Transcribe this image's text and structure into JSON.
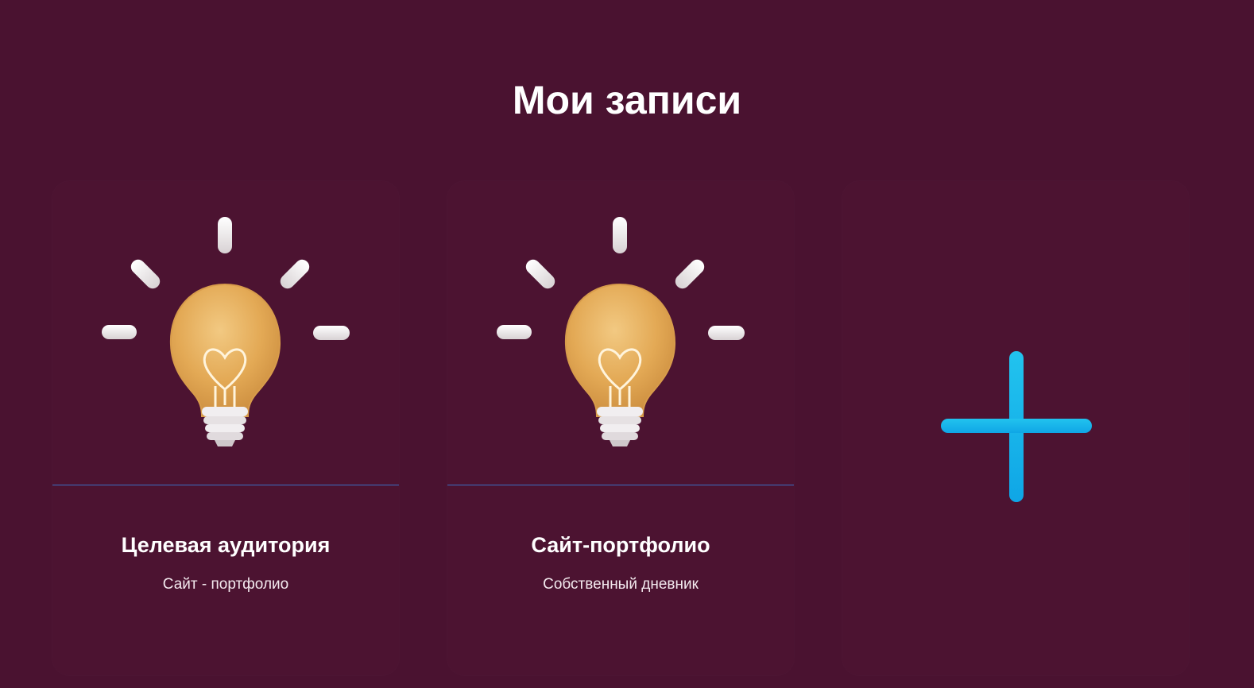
{
  "page": {
    "title": "Мои записи"
  },
  "cards": [
    {
      "title": "Целевая аудитория",
      "subtitle": "Сайт - портфолио",
      "icon": "lightbulb-icon"
    },
    {
      "title": "Сайт-портфолио",
      "subtitle": "Собственный дневник",
      "icon": "lightbulb-icon"
    }
  ],
  "add_card": {
    "icon": "plus-icon"
  },
  "colors": {
    "background": "#4a1230",
    "card": "#4c1331",
    "divider": "#3b6fc4",
    "accent_plus": "#1eb6ec",
    "bulb": "#e8b25e"
  }
}
